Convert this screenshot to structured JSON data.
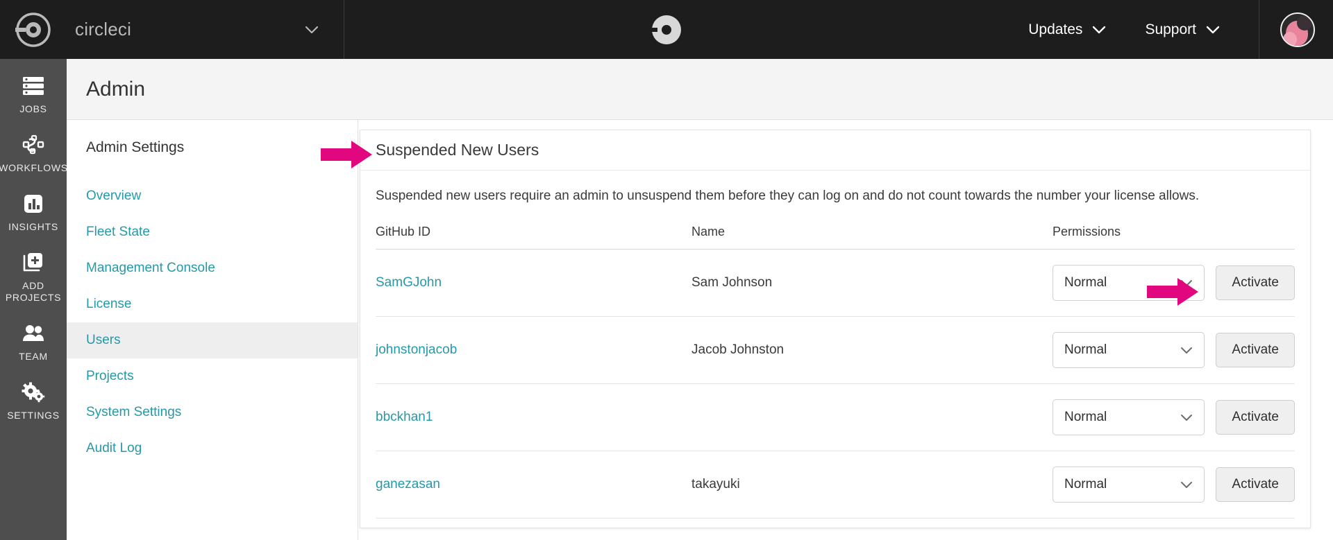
{
  "topbar": {
    "logo_icon": "circleci-logo-icon",
    "org_name": "circleci",
    "org_caret_icon": "chevron-down-icon",
    "center_logo_icon": "circleci-mark-icon",
    "links": [
      {
        "label": "Updates",
        "icon": "chevron-down-icon"
      },
      {
        "label": "Support",
        "icon": "chevron-down-icon"
      }
    ],
    "avatar_icon": "user-avatar"
  },
  "rail": {
    "items": [
      {
        "label": "JOBS",
        "icon": "jobs-list-icon"
      },
      {
        "label": "WORKFLOWS",
        "icon": "workflows-nodes-icon"
      },
      {
        "label": "INSIGHTS",
        "icon": "insights-bar-chart-icon"
      },
      {
        "label": "ADD\nPROJECTS",
        "label_line1": "ADD",
        "label_line2": "PROJECTS",
        "icon": "add-project-icon"
      },
      {
        "label": "TEAM",
        "icon": "team-people-icon"
      },
      {
        "label": "SETTINGS",
        "icon": "settings-gears-icon"
      }
    ]
  },
  "page": {
    "title": "Admin"
  },
  "subnav": {
    "title": "Admin Settings",
    "items": [
      {
        "label": "Overview",
        "active": false
      },
      {
        "label": "Fleet State",
        "active": false
      },
      {
        "label": "Management Console",
        "active": false
      },
      {
        "label": "License",
        "active": false
      },
      {
        "label": "Users",
        "active": true
      },
      {
        "label": "Projects",
        "active": false
      },
      {
        "label": "System Settings",
        "active": false
      },
      {
        "label": "Audit Log",
        "active": false
      }
    ]
  },
  "card": {
    "heading": "Suspended New Users",
    "description": "Suspended new users require an admin to unsuspend them before they can log on and do not count towards the number your license allows.",
    "columns": [
      "GitHub ID",
      "Name",
      "Permissions"
    ],
    "rows": [
      {
        "github_id": "SamGJohn",
        "name": "Sam Johnson",
        "permission": "Normal",
        "action": "Activate"
      },
      {
        "github_id": "johnstonjacob",
        "name": "Jacob Johnston",
        "permission": "Normal",
        "action": "Activate"
      },
      {
        "github_id": "bbckhan1",
        "name": "",
        "permission": "Normal",
        "action": "Activate"
      },
      {
        "github_id": "ganezasan",
        "name": "takayuki",
        "permission": "Normal",
        "action": "Activate"
      }
    ]
  },
  "annotations": {
    "color": "#e0077f",
    "arrows": [
      {
        "name": "arrow-pointing-to-heading",
        "target": "Suspended New Users"
      },
      {
        "name": "arrow-pointing-to-activate-button",
        "target": "Activate"
      }
    ]
  },
  "colors": {
    "topbar_bg": "#1d1d1d",
    "rail_bg": "#4e4e4e",
    "link_teal": "#2599a8",
    "annotation_pink": "#e0077f",
    "active_row_bg": "#eeeeee"
  }
}
